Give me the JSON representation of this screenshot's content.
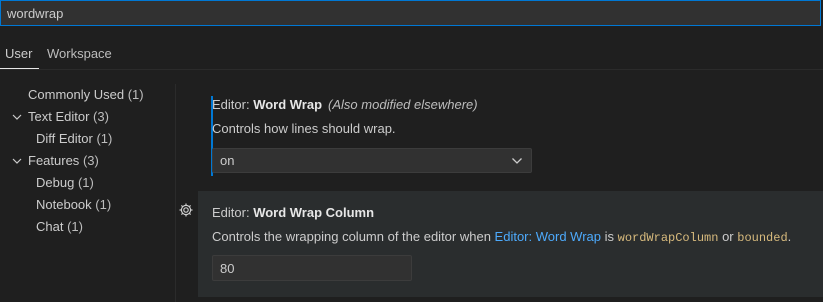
{
  "search": {
    "value": "wordwrap"
  },
  "tabs": [
    {
      "label": "User"
    },
    {
      "label": "Workspace"
    }
  ],
  "toc": [
    {
      "label": "Commonly Used",
      "count": "(1)"
    },
    {
      "label": "Text Editor",
      "count": "(3)"
    },
    {
      "label": "Diff Editor",
      "count": "(1)"
    },
    {
      "label": "Features",
      "count": "(3)"
    },
    {
      "label": "Debug",
      "count": "(1)"
    },
    {
      "label": "Notebook",
      "count": "(1)"
    },
    {
      "label": "Chat",
      "count": "(1)"
    }
  ],
  "settings": {
    "word_wrap": {
      "category": "Editor: ",
      "name": "Word Wrap",
      "note": "(Also modified elsewhere)",
      "description": "Controls how lines should wrap.",
      "value": "on"
    },
    "word_wrap_column": {
      "category": "Editor: ",
      "name": "Word Wrap Column",
      "desc_prefix": "Controls the wrapping column of the editor when ",
      "desc_link": "Editor: Word Wrap",
      "desc_is": " is ",
      "desc_code1": "wordWrapColumn",
      "desc_or": " or ",
      "desc_code2": "bounded",
      "desc_end": ".",
      "value": "80"
    }
  },
  "icons": {
    "chevron": "chevron-down-icon",
    "gear": "gear-icon"
  },
  "colors": {
    "accent": "#0078d4",
    "link": "#4daafc",
    "code": "#d7ba7d",
    "background": "#1f1f1f"
  }
}
